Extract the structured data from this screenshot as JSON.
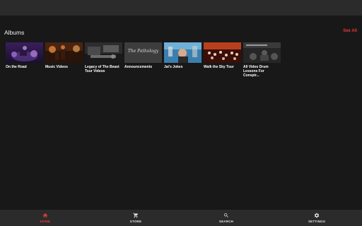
{
  "section": {
    "title": "Albums",
    "see_all": "See All"
  },
  "albums": [
    {
      "label": "On the Road"
    },
    {
      "label": "Music Videos"
    },
    {
      "label": "Legacy of The Beast Tour Videos"
    },
    {
      "label": "Announcements",
      "thumb_text": "The Pathology"
    },
    {
      "label": "Jai's Jokes"
    },
    {
      "label": "Walk the Sky Tour"
    },
    {
      "label": "All Video Drum Lessons For Conspir..."
    }
  ],
  "nav": {
    "items": [
      {
        "label": "HOME",
        "icon": "home-icon",
        "active": true
      },
      {
        "label": "STORE",
        "icon": "cart-icon",
        "active": false
      },
      {
        "label": "SEARCH",
        "icon": "search-icon",
        "active": false
      },
      {
        "label": "SETTINGS",
        "icon": "gear-icon",
        "active": false
      }
    ],
    "active_color": "#e53935",
    "inactive_color": "#e0e0e0"
  },
  "colors": {
    "background": "#181818",
    "bars": "#2b2b2b",
    "accent": "#e53935"
  }
}
